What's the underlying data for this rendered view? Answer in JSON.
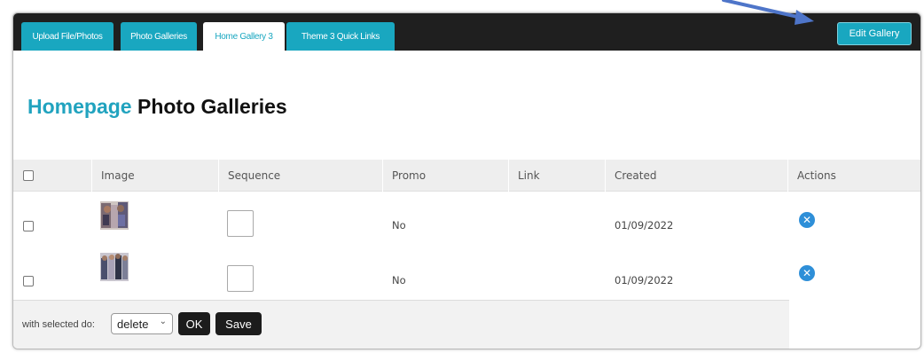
{
  "tabs": [
    {
      "label": "Upload File/Photos",
      "active": false
    },
    {
      "label": "Photo Galleries",
      "active": false
    },
    {
      "label": "Home Gallery 3",
      "active": true
    },
    {
      "label": "Theme 3 Quick Links",
      "active": false
    }
  ],
  "edit_button_label": "Edit Gallery",
  "page_title": {
    "accent": "Homepage",
    "rest": "Photo Galleries"
  },
  "table": {
    "columns": [
      "Image",
      "Sequence",
      "Promo",
      "Link",
      "Created",
      "Actions"
    ],
    "rows": [
      {
        "promo": "No",
        "link": "",
        "created": "01/09/2022",
        "sequence": ""
      },
      {
        "promo": "No",
        "link": "",
        "created": "01/09/2022",
        "sequence": ""
      }
    ]
  },
  "footer": {
    "label": "with selected do:",
    "action_selected": "delete",
    "ok_label": "OK",
    "save_label": "Save"
  },
  "icons": {
    "delete_row": "circle-x-icon",
    "annotation": "arrow-pointer-icon",
    "select_chevron": "chevron-down-icon"
  },
  "colors": {
    "accent": "#19a7c0",
    "topbar": "#1f1f1f",
    "delete_icon": "#2e8fd8",
    "arrow": "#4e75c9"
  }
}
